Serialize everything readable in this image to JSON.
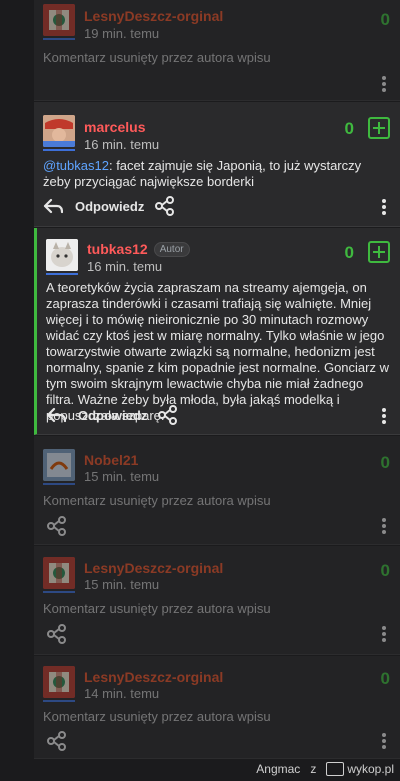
{
  "comments": [
    {
      "author": "LesnyDeszcz-orginal",
      "time": "19 min. temu",
      "score": "0",
      "text": "Komentarz usunięty przez autora wpisu",
      "deleted": true
    },
    {
      "author": "marcelus",
      "time": "16 min. temu",
      "score": "0",
      "mention": "@tubkas12",
      "text": ": facet zajmuje się Japonią, to już wystarczy żeby przyciągać największe borderki",
      "reply_label": "Odpowiedz"
    },
    {
      "author": "tubkas12",
      "badge": "Autor",
      "time": "16 min. temu",
      "score": "0",
      "text": "A teoretyków życia zapraszam na streamy ajemgeja, on zaprasza tinderówki i czasami trafiają się walnięte. Mniej więcej i to mówię nieironicznie po 30 minutach rozmowy widać czy ktoś jest w miarę normalny. Tylko właśnie w jego towarzystwie otwarte związki są normalne, hedonizm jest normalny, spanie z kim popadnie jest normalne. Gonciarz w tym swoim skrajnym lewactwie chyba nie miał żadnego filtra. Ważne żeby była młoda, była jakąś modelką i popuszczała szparę.",
      "reply_label": "Odpowiedz"
    },
    {
      "author": "Nobel21",
      "time": "15 min. temu",
      "score": "0",
      "text": "Komentarz usunięty przez autora wpisu",
      "deleted": true
    },
    {
      "author": "LesnyDeszcz-orginal",
      "time": "15 min. temu",
      "score": "0",
      "text": "Komentarz usunięty przez autora wpisu",
      "deleted": true
    },
    {
      "author": "LesnyDeszcz-orginal",
      "time": "14 min. temu",
      "score": "0",
      "text": "Komentarz usunięty przez autora wpisu",
      "deleted": true
    }
  ],
  "watermark": {
    "author": "Angmac",
    "separator": "z",
    "site": "wykop.pl"
  },
  "colors": {
    "accent_green": "#3fb93f",
    "author_orange": "#e8542c",
    "author_red": "#ff5a5a",
    "mention_blue": "#5fa4ff"
  }
}
